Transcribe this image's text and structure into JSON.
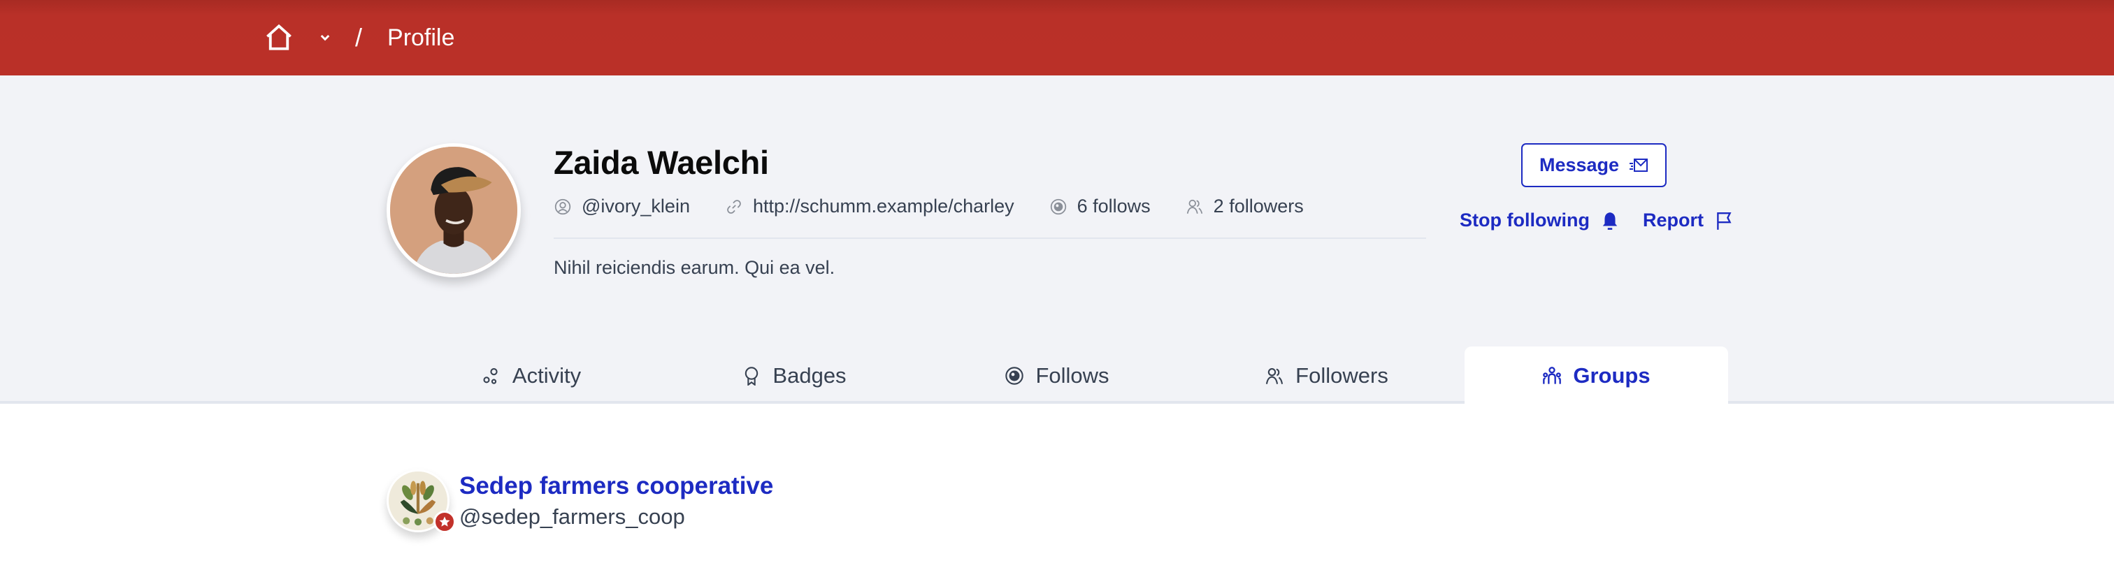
{
  "header": {
    "home_icon": "home-icon",
    "menu_icon": "chevron-down-icon",
    "separator": "/",
    "current_page": "Profile"
  },
  "profile": {
    "name": "Zaida Waelchi",
    "nickname": "@ivory_klein",
    "website": "http://schumm.example/charley",
    "follows": "6 follows",
    "followers": "2 followers",
    "bio": "Nihil reiciendis earum. Qui ea vel.",
    "avatar_alt": "Avatar of Zaida Waelchi"
  },
  "actions": {
    "message": "Message",
    "stop_following": "Stop following",
    "report": "Report"
  },
  "tabs": [
    {
      "label": "Activity",
      "icon": "activity-icon",
      "active": false
    },
    {
      "label": "Badges",
      "icon": "badge-icon",
      "active": false
    },
    {
      "label": "Follows",
      "icon": "eye-icon",
      "active": false
    },
    {
      "label": "Followers",
      "icon": "users-icon",
      "active": false
    },
    {
      "label": "Groups",
      "icon": "group-icon",
      "active": true
    }
  ],
  "groups": [
    {
      "title": "Sedep farmers cooperative",
      "handle": "@sedep_farmers_coop",
      "badge": "star-icon"
    }
  ],
  "colors": {
    "header_bg": "#b93028",
    "accent": "#1d2bc2",
    "band_bg": "#f2f3f7",
    "text": "#374151",
    "badge": "#c2312a"
  }
}
